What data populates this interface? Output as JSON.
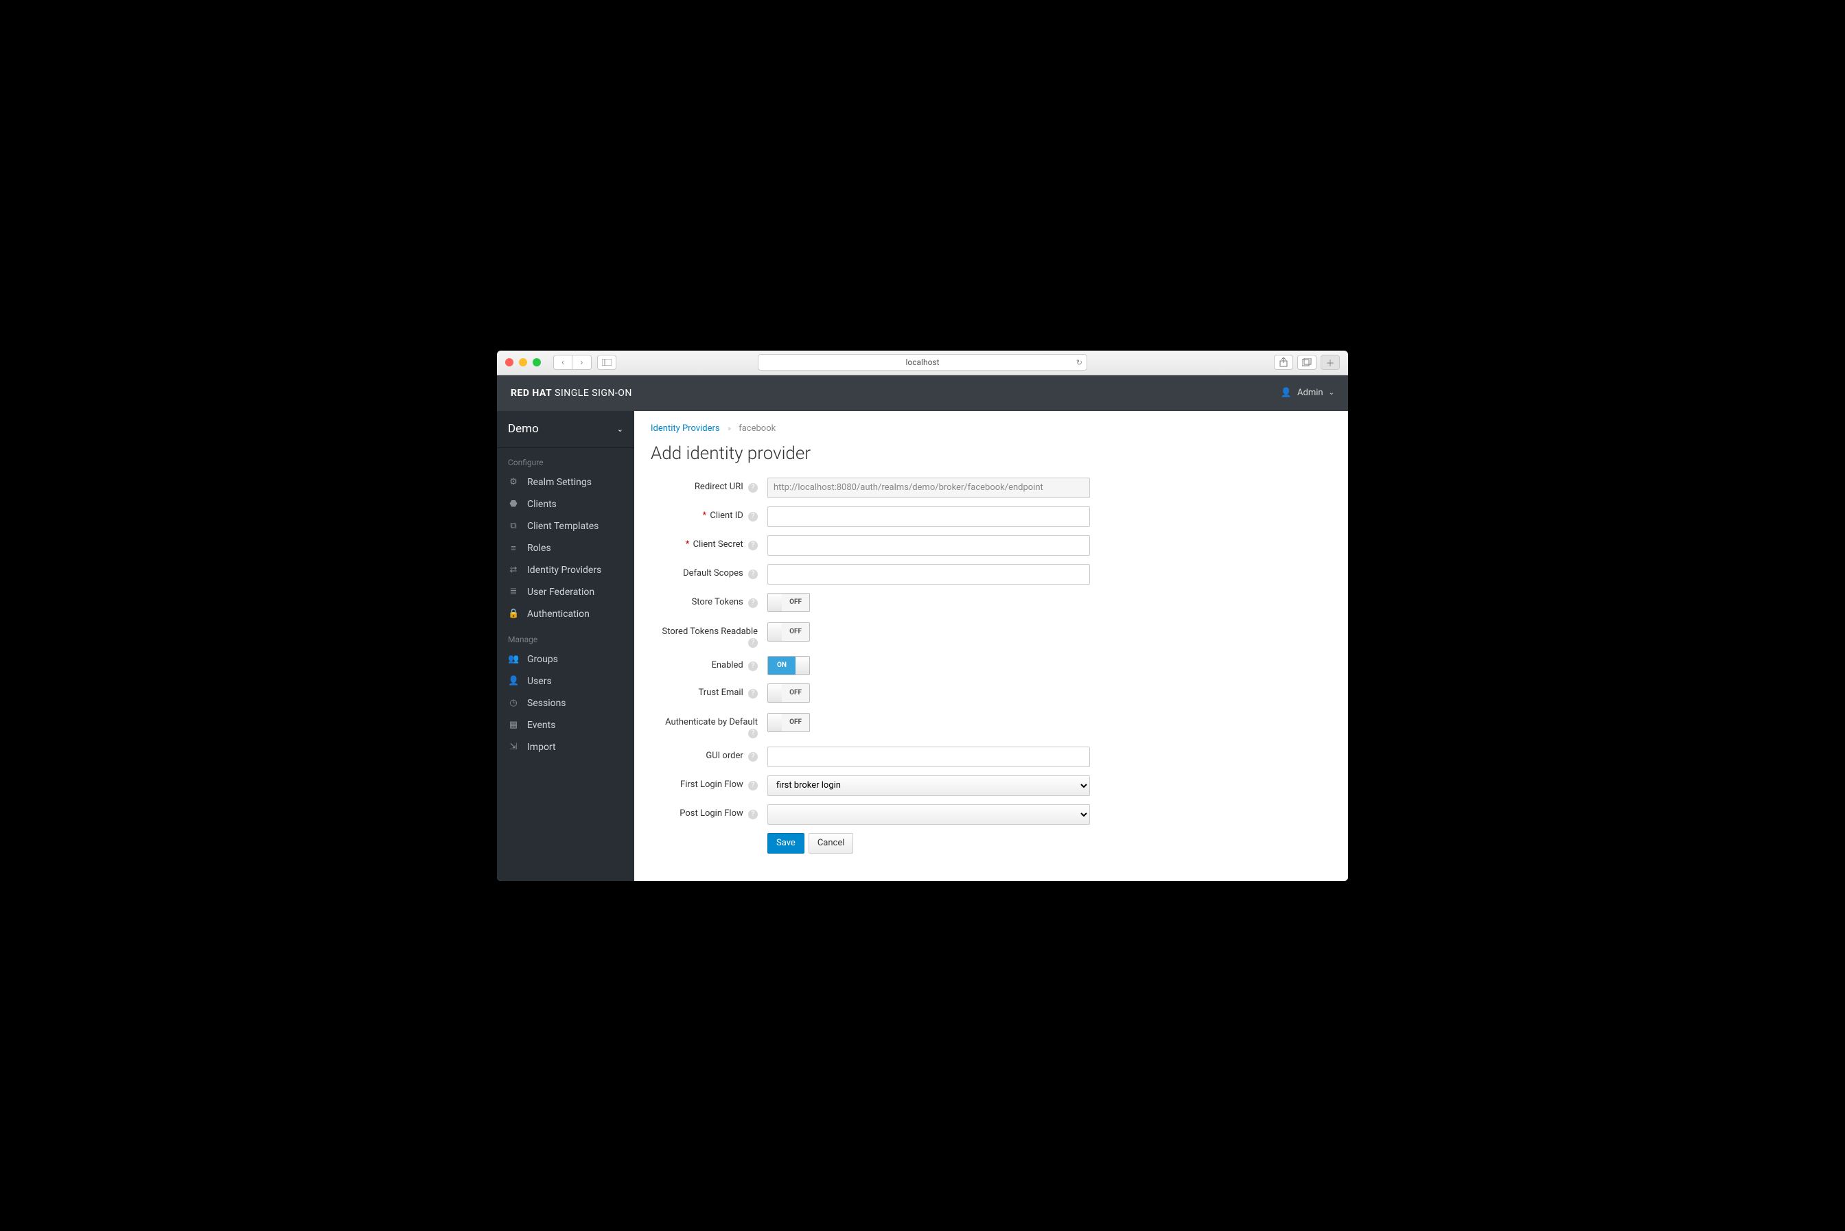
{
  "browser": {
    "url": "localhost"
  },
  "brand": {
    "bold": "RED HAT",
    "rest": " SINGLE SIGN-ON"
  },
  "user": {
    "name": "Admin"
  },
  "realm": {
    "name": "Demo"
  },
  "sidebar": {
    "sections": [
      {
        "title": "Configure",
        "items": [
          {
            "icon": "⚙",
            "label": "Realm Settings"
          },
          {
            "icon": "⬣",
            "label": "Clients"
          },
          {
            "icon": "⧉",
            "label": "Client Templates"
          },
          {
            "icon": "≡",
            "label": "Roles"
          },
          {
            "icon": "⇄",
            "label": "Identity Providers"
          },
          {
            "icon": "≣",
            "label": "User Federation"
          },
          {
            "icon": "🔒",
            "label": "Authentication"
          }
        ]
      },
      {
        "title": "Manage",
        "items": [
          {
            "icon": "👥",
            "label": "Groups"
          },
          {
            "icon": "👤",
            "label": "Users"
          },
          {
            "icon": "◷",
            "label": "Sessions"
          },
          {
            "icon": "▦",
            "label": "Events"
          },
          {
            "icon": "⇲",
            "label": "Import"
          }
        ]
      }
    ]
  },
  "breadcrumb": {
    "parent": "Identity Providers",
    "current": "facebook"
  },
  "page": {
    "title": "Add identity provider"
  },
  "form": {
    "redirect_uri": {
      "label": "Redirect URI",
      "value": "http://localhost:8080/auth/realms/demo/broker/facebook/endpoint"
    },
    "client_id": {
      "label": "Client ID",
      "value": "",
      "required": true
    },
    "client_secret": {
      "label": "Client Secret",
      "value": "",
      "required": true
    },
    "default_scopes": {
      "label": "Default Scopes",
      "value": ""
    },
    "store_tokens": {
      "label": "Store Tokens",
      "value": "OFF"
    },
    "stored_tokens_readable": {
      "label": "Stored Tokens Readable",
      "value": "OFF"
    },
    "enabled": {
      "label": "Enabled",
      "value": "ON"
    },
    "trust_email": {
      "label": "Trust Email",
      "value": "OFF"
    },
    "authenticate_by_default": {
      "label": "Authenticate by Default",
      "value": "OFF"
    },
    "gui_order": {
      "label": "GUI order",
      "value": ""
    },
    "first_login_flow": {
      "label": "First Login Flow",
      "value": "first broker login"
    },
    "post_login_flow": {
      "label": "Post Login Flow",
      "value": ""
    }
  },
  "buttons": {
    "save": "Save",
    "cancel": "Cancel"
  }
}
